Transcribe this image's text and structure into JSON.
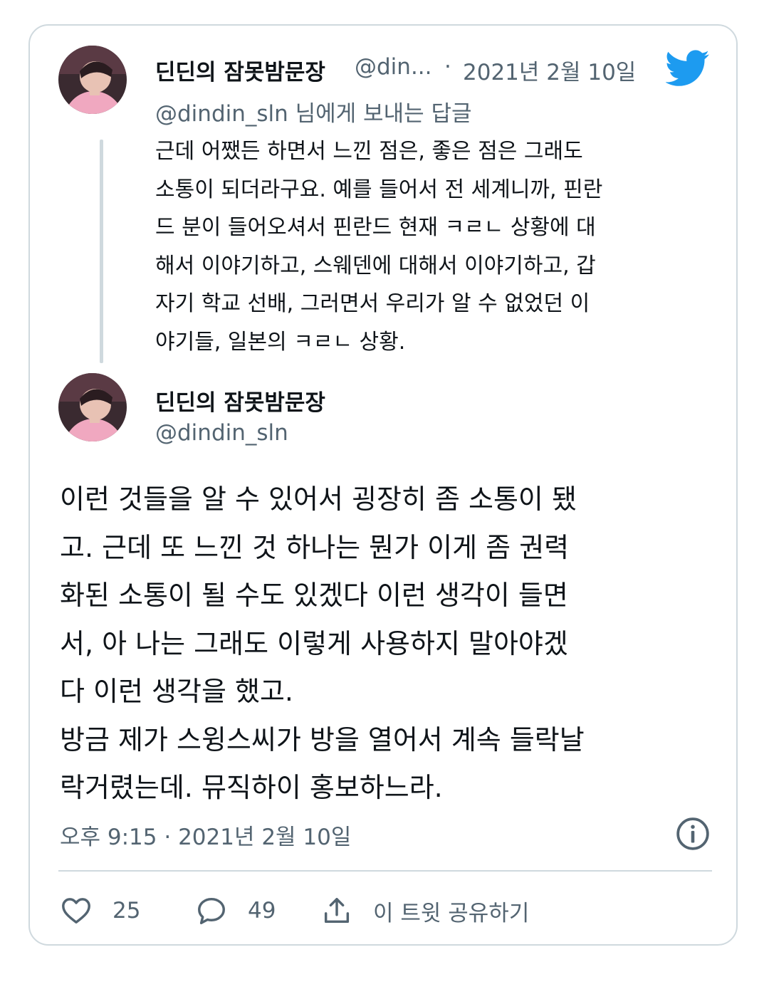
{
  "reply_tweet": {
    "author_name": "딘딘의 잠못밤문장",
    "author_handle_truncated": "@din...",
    "separator": "·",
    "date": "2021년 2월 10일",
    "replying_to": "@dindin_sln 님에게 보내는 답글",
    "text": "근데 어쨌든 하면서 느낀 점은, 좋은 점은 그래도\n소통이 되더라구요. 예를 들어서 전 세계니까, 핀란\n드 분이 들어오셔서 핀란드 현재 ㅋㄹㄴ 상황에 대\n해서 이야기하고, 스웨덴에 대해서 이야기하고, 갑\n자기 학교 선배, 그러면서 우리가 알 수 없었던 이\n야기들, 일본의 ㅋㄹㄴ 상황."
  },
  "main_tweet": {
    "author_name": "딘딘의 잠못밤문장",
    "author_handle": "@dindin_sln",
    "text": "이런 것들을 알 수 있어서 굉장히 좀 소통이 됐\n고. 근데 또 느낀 것 하나는 뭔가 이게 좀 권력\n화된 소통이 될 수도 있겠다 이런 생각이 들면\n서, 아 나는 그래도 이렇게 사용하지 말아야겠\n다 이런 생각을 했고.\n방금 제가 스윙스씨가 방을 열어서 계속 들락날\n락거렸는데. 뮤직하이 홍보하느라.",
    "timestamp": "오후 9:15 · 2021년 2월 10일"
  },
  "actions": {
    "likes": "25",
    "replies": "49",
    "share_label": "이 트윗 공유하기"
  },
  "colors": {
    "twitter_blue": "#1d9bf0",
    "text_primary": "#0f1419",
    "text_secondary": "#536471",
    "border": "#cfd9de"
  },
  "icons": [
    "twitter-bird-icon",
    "info-icon",
    "heart-icon",
    "reply-bubble-icon",
    "share-icon"
  ]
}
